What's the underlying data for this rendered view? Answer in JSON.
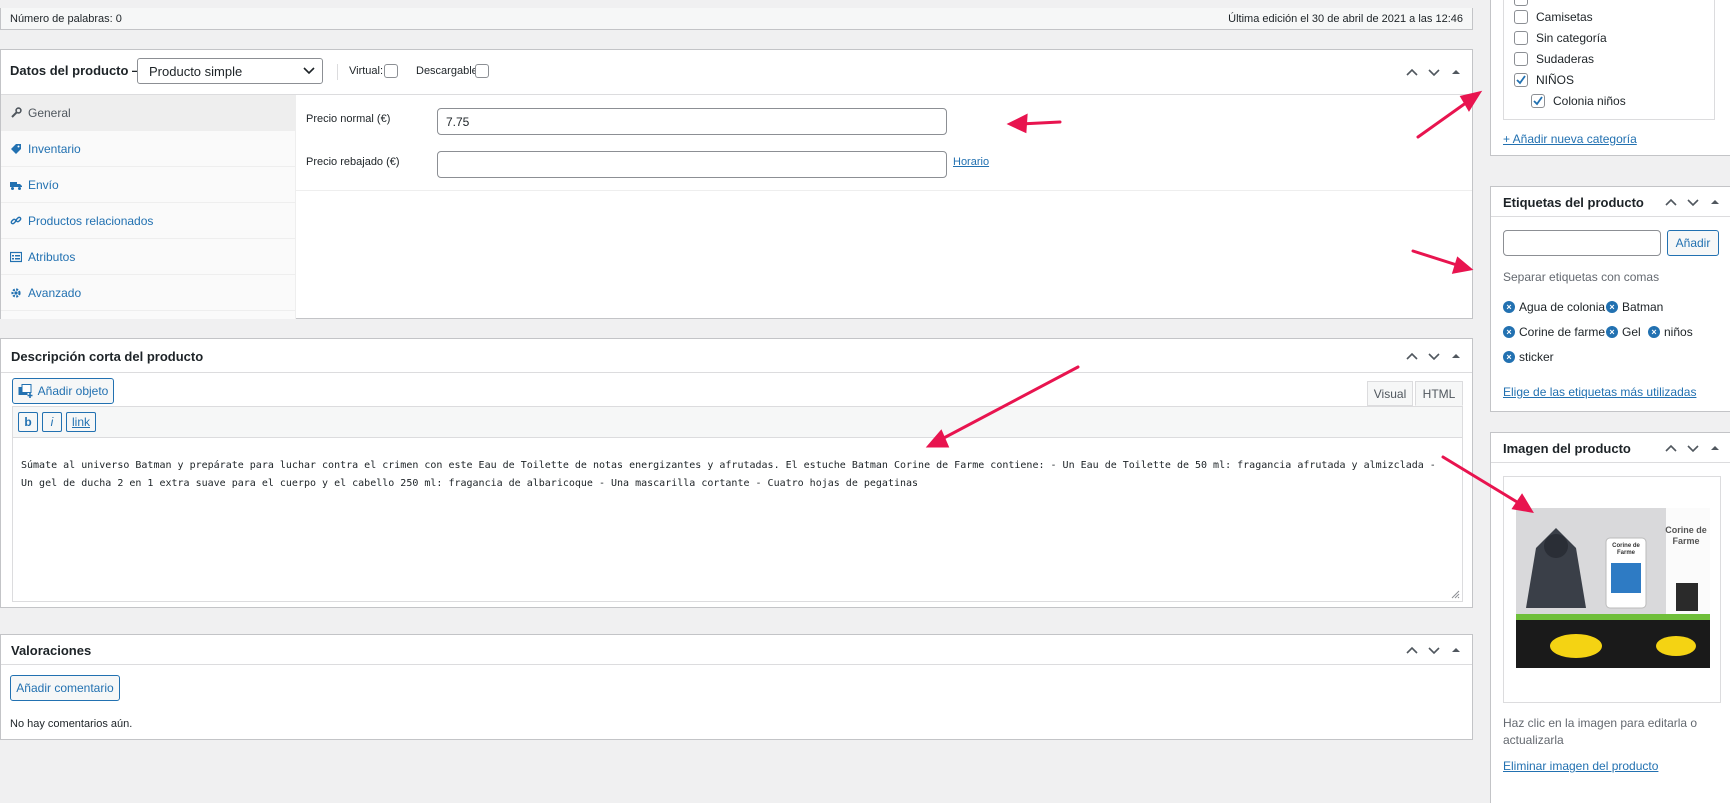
{
  "status_bar": {
    "word_count": "Número de palabras: 0",
    "last_edit": "Última edición el 30 de abril de 2021 a las 12:46"
  },
  "product_data": {
    "title": "Datos del producto —",
    "type_selected": "Producto simple",
    "virtual_label": "Virtual:",
    "downloadable_label": "Descargable:",
    "tabs": [
      {
        "label": "General",
        "icon": "wrench-icon"
      },
      {
        "label": "Inventario",
        "icon": "tag-icon"
      },
      {
        "label": "Envío",
        "icon": "truck-icon"
      },
      {
        "label": "Productos relacionados",
        "icon": "link-icon"
      },
      {
        "label": "Atributos",
        "icon": "list-icon"
      },
      {
        "label": "Avanzado",
        "icon": "gear-icon"
      }
    ],
    "regular_price_label": "Precio normal (€)",
    "regular_price_value": "7.75",
    "sale_price_label": "Precio rebajado (€)",
    "sale_price_value": "",
    "schedule_link": "Horario"
  },
  "short_description": {
    "title": "Descripción corta del producto",
    "add_media": "Añadir objeto",
    "tab_visual": "Visual",
    "tab_html": "HTML",
    "quicktags": [
      "b",
      "i",
      "link"
    ],
    "content": "Súmate al universo Batman y prepárate para luchar contra el crimen con este Eau de Toilette de notas energizantes y afrutadas. El estuche Batman Corine de Farme contiene: - Un Eau de Toilette de 50 ml: fragancia afrutada y almizclada - Un gel de ducha 2 en 1 extra suave para el cuerpo y el cabello 250 ml: fragancia de albaricoque - Una mascarilla cortante - Cuatro hojas de pegatinas"
  },
  "reviews": {
    "title": "Valoraciones",
    "add_comment": "Añadir comentario",
    "empty": "No hay comentarios aún."
  },
  "categories": {
    "items": [
      {
        "label": "Camisetas",
        "checked": false,
        "indent": 0
      },
      {
        "label": "Sin categoría",
        "checked": false,
        "indent": 0
      },
      {
        "label": "Sudaderas",
        "checked": false,
        "indent": 0
      },
      {
        "label": "NIÑOS",
        "checked": true,
        "indent": 0
      },
      {
        "label": "Colonia niños",
        "checked": true,
        "indent": 1
      }
    ],
    "add_new": "+ Añadir nueva categoría"
  },
  "tags": {
    "title": "Etiquetas del producto",
    "input_value": "",
    "add_button": "Añadir",
    "hint": "Separar etiquetas con comas",
    "items": [
      "Agua de colonia",
      "Batman",
      "Corine de farme",
      "Gel",
      "niños",
      "sticker"
    ],
    "most_used_link": "Elige de las etiquetas más utilizadas"
  },
  "product_image": {
    "title": "Imagen del producto",
    "image_brand_text": "Corine de Farme",
    "image_box_text": "Corine de Farme",
    "help": "Haz clic en la imagen para editarla o actualizarla",
    "remove_link": "Eliminar imagen del producto"
  },
  "colors": {
    "accent": "#2271b1",
    "annotation_arrow": "#e8144f"
  }
}
